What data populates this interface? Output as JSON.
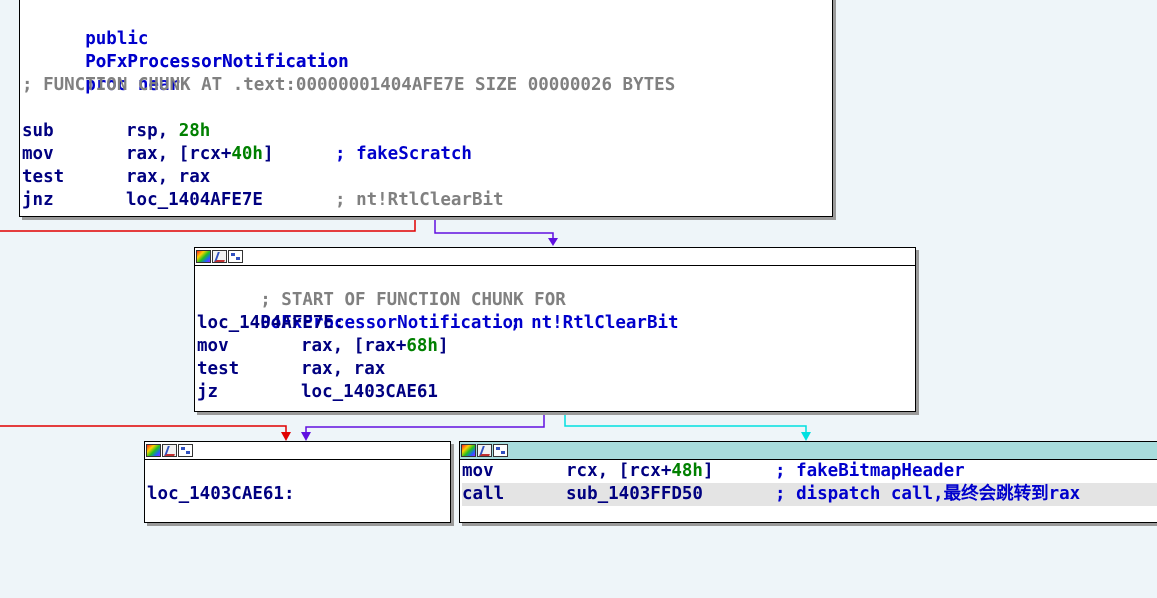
{
  "colors": {
    "background": "#eef5f9",
    "edge_false": "#e00000",
    "edge_true": "#6010e0",
    "edge_next": "#00e0e0",
    "header_cyan": "#a8dcdc"
  },
  "node1": {
    "lines": [
      {
        "mnemonic": "public",
        "text": "PoFxProcessorNotification"
      },
      {
        "mnemonic": "PoFxProcessorNotification",
        "text": "proc near"
      },
      {
        "comment": "; FUNCTION CHUNK AT .text:00000001404AFE7E SIZE 00000026 BYTES"
      },
      {
        "mnemonic": "sub",
        "reg": "rsp,",
        "imm": "28h"
      },
      {
        "mnemonic": "mov",
        "reg": "rax, [rcx+",
        "imm": "40h",
        "reg_end": "]",
        "comment": "; fakeScratch"
      },
      {
        "mnemonic": "test",
        "reg": "rax, rax"
      },
      {
        "mnemonic": "jnz",
        "reg": "loc_1404AFE7E",
        "comment": "; nt!RtlClearBit"
      }
    ]
  },
  "node2": {
    "icons": [
      "color-icon",
      "edit-icon",
      "graph-icon"
    ],
    "chunk_comment": "; START OF FUNCTION CHUNK FOR",
    "chunk_func": "PoFxProcessorNotification",
    "label": "loc_1404AFE7E:",
    "label_comment": "; nt!RtlClearBit",
    "lines": [
      {
        "mnemonic": "mov",
        "reg": "rax, [rax+",
        "imm": "68h",
        "reg_end": "]"
      },
      {
        "mnemonic": "test",
        "reg": "rax, rax"
      },
      {
        "mnemonic": "jz",
        "reg": "loc_1403CAE61"
      }
    ]
  },
  "node3": {
    "label": "loc_1403CAE61:"
  },
  "node4": {
    "lines": [
      {
        "mnemonic": "mov",
        "reg": "rcx, [rcx+",
        "imm": "48h",
        "reg_end": "]",
        "comment": "; fakeBitmapHeader"
      },
      {
        "mnemonic": "call",
        "reg": "sub_1403FFD50",
        "comment": "; dispatch call,最终会跳转到rax"
      }
    ]
  }
}
